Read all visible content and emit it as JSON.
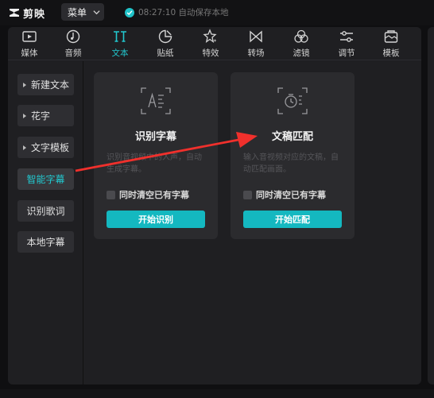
{
  "app": {
    "name": "剪映"
  },
  "header": {
    "menu_label": "菜单",
    "save_status": "08:27:10 自动保存本地"
  },
  "toolbar": {
    "active": "文本",
    "items": [
      {
        "label": "媒体",
        "icon": "media-icon"
      },
      {
        "label": "音频",
        "icon": "audio-icon"
      },
      {
        "label": "文本",
        "icon": "text-icon"
      },
      {
        "label": "贴纸",
        "icon": "sticker-icon"
      },
      {
        "label": "特效",
        "icon": "effects-icon"
      },
      {
        "label": "转场",
        "icon": "transition-icon"
      },
      {
        "label": "滤镜",
        "icon": "filter-icon"
      },
      {
        "label": "调节",
        "icon": "adjust-icon"
      },
      {
        "label": "模板",
        "icon": "template-icon"
      }
    ]
  },
  "sidebar": {
    "active": "智能字幕",
    "items": [
      {
        "label": "新建文本",
        "has_arrow": true
      },
      {
        "label": "花字",
        "has_arrow": true
      },
      {
        "label": "文字模板",
        "has_arrow": true
      },
      {
        "label": "智能字幕",
        "has_arrow": false
      },
      {
        "label": "识别歌词",
        "has_arrow": false
      },
      {
        "label": "本地字幕",
        "has_arrow": false
      }
    ]
  },
  "cards": [
    {
      "title": "识别字幕",
      "description": "识别音视频中的人声，自动生成字幕。",
      "checkbox_label": "同时清空已有字幕",
      "checked": false,
      "button_label": "开始识别",
      "icon": "speech-recognition-icon"
    },
    {
      "title": "文稿匹配",
      "description": "输入音视频对应的文稿，自动匹配画面。",
      "checkbox_label": "同时清空已有字幕",
      "checked": false,
      "button_label": "开始匹配",
      "icon": "script-match-icon"
    }
  ],
  "colors": {
    "accent": "#22c8cf",
    "button": "#14b8c0",
    "annotation_arrow": "#f0302c"
  }
}
